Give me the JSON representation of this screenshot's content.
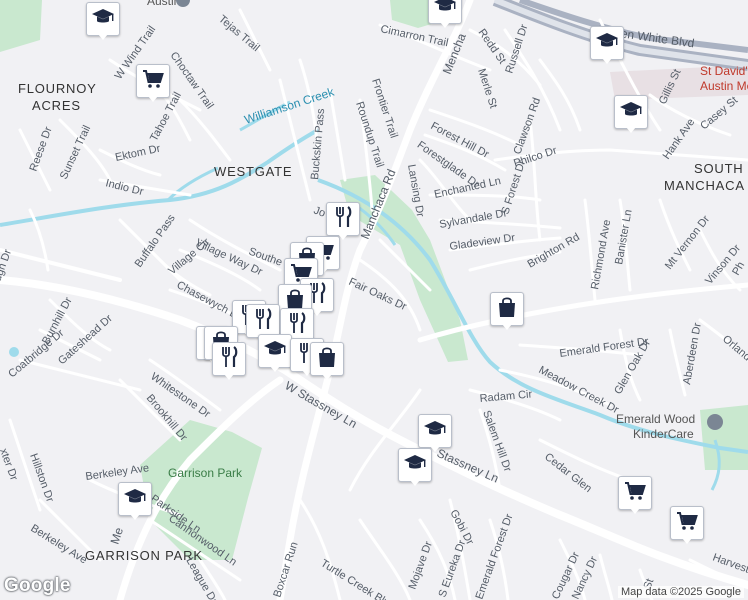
{
  "map": {
    "areas": {
      "flournoy_acres_1": "FLOURNOY",
      "flournoy_acres_2": "ACRES",
      "westgate": "WESTGATE",
      "south_manchaca_1": "SOUTH",
      "south_manchaca_2": "MANCHACA",
      "garrison_park": "GARRISON PARK"
    },
    "parks": {
      "garrison_park": "Garrison Park"
    },
    "water": {
      "williamson_creek": "Williamson Creek"
    },
    "pois": {
      "st_davids_1": "St David's",
      "st_davids_2": "Austin Me",
      "emerald_wood_1": "Emerald Wood",
      "emerald_wood_2": "KinderCare",
      "top_partial": "Austin"
    },
    "streets": {
      "ben_white": "W Ben White Blvd",
      "cimarron": "Cimarron Trail",
      "redd": "Redd St",
      "russell": "Russell Dr",
      "merle": "Merle St",
      "gillis": "Gillis St",
      "casey": "Casey St",
      "hank": "Hank Ave",
      "forest_hill": "Forest Hill Dr",
      "forestglade": "Forestglade Dr",
      "clawson": "Clawson Rd",
      "philco": "Philco Dr",
      "frontier": "Frontier Trail",
      "roundup": "Roundup Trail",
      "manchaca": "Manchaca Rd",
      "menchaca_partial": "Mencha",
      "lansing": "Lansing Dr",
      "enchanted": "Enchanted Ln",
      "s_forest": "S Forest Dr",
      "sylvandale": "Sylvandale Dr",
      "gladeview": "Gladeview Dr",
      "brighton": "Brighton Rd",
      "richmond": "Richmond Ave",
      "banister": "Banister Ln",
      "mt_vernon": "Mt Vernon Dr",
      "vinson": "Vinson Dr",
      "fair_oaks": "Fair Oaks Dr",
      "emerald_forest": "Emerald Forest Dr",
      "glen_oak": "Glen Oak Dr",
      "aberdeen": "Aberdeen Dr",
      "meadow_creek": "Meadow Creek Dr",
      "radam": "Radam Cir",
      "salem_hill": "Salem Hill Dr",
      "cedar_glen": "Cedar Glen",
      "stassney_w": "W Stassney Ln",
      "stassney_e": "Stassney Ln",
      "tejas": "Tejas Trail",
      "w_wind": "W Wind Trail",
      "choctaw": "Choctaw Trail",
      "tahoe": "Tahoe Trail",
      "buckskin": "Buckskin Pass",
      "reese": "Reese Dr",
      "sunset": "Sunset Trail",
      "ektom": "Ektom Dr",
      "indio": "Indio Dr",
      "jo_partial": "Jo",
      "buffalo": "Buffalo Pass",
      "village_way": "Village Way Dr",
      "village_cir": "Village Cir",
      "southern_partial": "Southe",
      "chasewych": "Chasewych Dr",
      "burnhill": "Burnhill Dr",
      "gateshead": "Gateshead Dr",
      "coatbridge": "Coatbridge Dr",
      "whitestone": "Whitestone Dr",
      "brookhill": "Brookhill Dr",
      "hillston": "Hillston Dr",
      "berkeley": "Berkeley Ave",
      "parkside": "Parkside Ln",
      "cannonwood": "Cannonwood Ln",
      "league_partial": "League Dr",
      "boxcar": "Boxcar Run",
      "turtle_creek": "Turtle Creek Blvd",
      "mojave": "Mojave Dr",
      "eureka": "S Eureka Dr",
      "gobi": "Gobi Dr",
      "cougar": "Cougar Dr",
      "nancy": "Nancy Dr",
      "harvest_partial": "Harvest",
      "orlando_partial": "Orlando",
      "ph_partial": "Ph",
      "ugh_partial": "ugh Dr",
      "xter_partial": "xter Dr",
      "manchaca_lower_partial": "Me",
      "st_partial": "St"
    },
    "footer": {
      "logo": "Google",
      "attribution": "Map data ©2025 Google"
    },
    "colors": {
      "background": "#f1f1f4",
      "park": "#c9e8cf",
      "water": "#9fdbeb",
      "road": "#ffffff",
      "highway": "#aab2c2",
      "pin_icon": "#1f2a44"
    }
  },
  "markers": [
    {
      "id": "edu-top",
      "icon": "school-icon"
    },
    {
      "id": "edu-nw",
      "icon": "school-icon"
    },
    {
      "id": "shop-nw",
      "icon": "shopping-cart-icon"
    },
    {
      "id": "edu-ne-1",
      "icon": "school-icon"
    },
    {
      "id": "edu-ne-2",
      "icon": "school-icon"
    },
    {
      "id": "bag-east",
      "icon": "shopping-bag-icon"
    },
    {
      "id": "food-1",
      "icon": "fork-knife-icon"
    },
    {
      "id": "cart-c1",
      "icon": "shopping-cart-icon"
    },
    {
      "id": "bag-c1",
      "icon": "shopping-bag-icon"
    },
    {
      "id": "cart-c2",
      "icon": "shopping-cart-icon"
    },
    {
      "id": "food-2",
      "icon": "fork-knife-icon"
    },
    {
      "id": "bag-c2",
      "icon": "shopping-bag-icon"
    },
    {
      "id": "food-3",
      "icon": "fork-knife-icon"
    },
    {
      "id": "food-4",
      "icon": "fork-knife-icon"
    },
    {
      "id": "food-5",
      "icon": "fork-knife-icon"
    },
    {
      "id": "food-6",
      "icon": "fork-knife-icon"
    },
    {
      "id": "bag-c3",
      "icon": "shopping-bag-icon"
    },
    {
      "id": "food-7",
      "icon": "fork-knife-icon"
    },
    {
      "id": "edu-c",
      "icon": "school-icon"
    },
    {
      "id": "food-8",
      "icon": "fork-knife-icon"
    },
    {
      "id": "bag-c4",
      "icon": "shopping-bag-icon"
    },
    {
      "id": "edu-s1",
      "icon": "school-icon"
    },
    {
      "id": "edu-s2",
      "icon": "school-icon"
    },
    {
      "id": "edu-sw",
      "icon": "school-icon"
    },
    {
      "id": "cart-se1",
      "icon": "shopping-cart-icon"
    },
    {
      "id": "cart-se2",
      "icon": "shopping-cart-icon"
    }
  ]
}
